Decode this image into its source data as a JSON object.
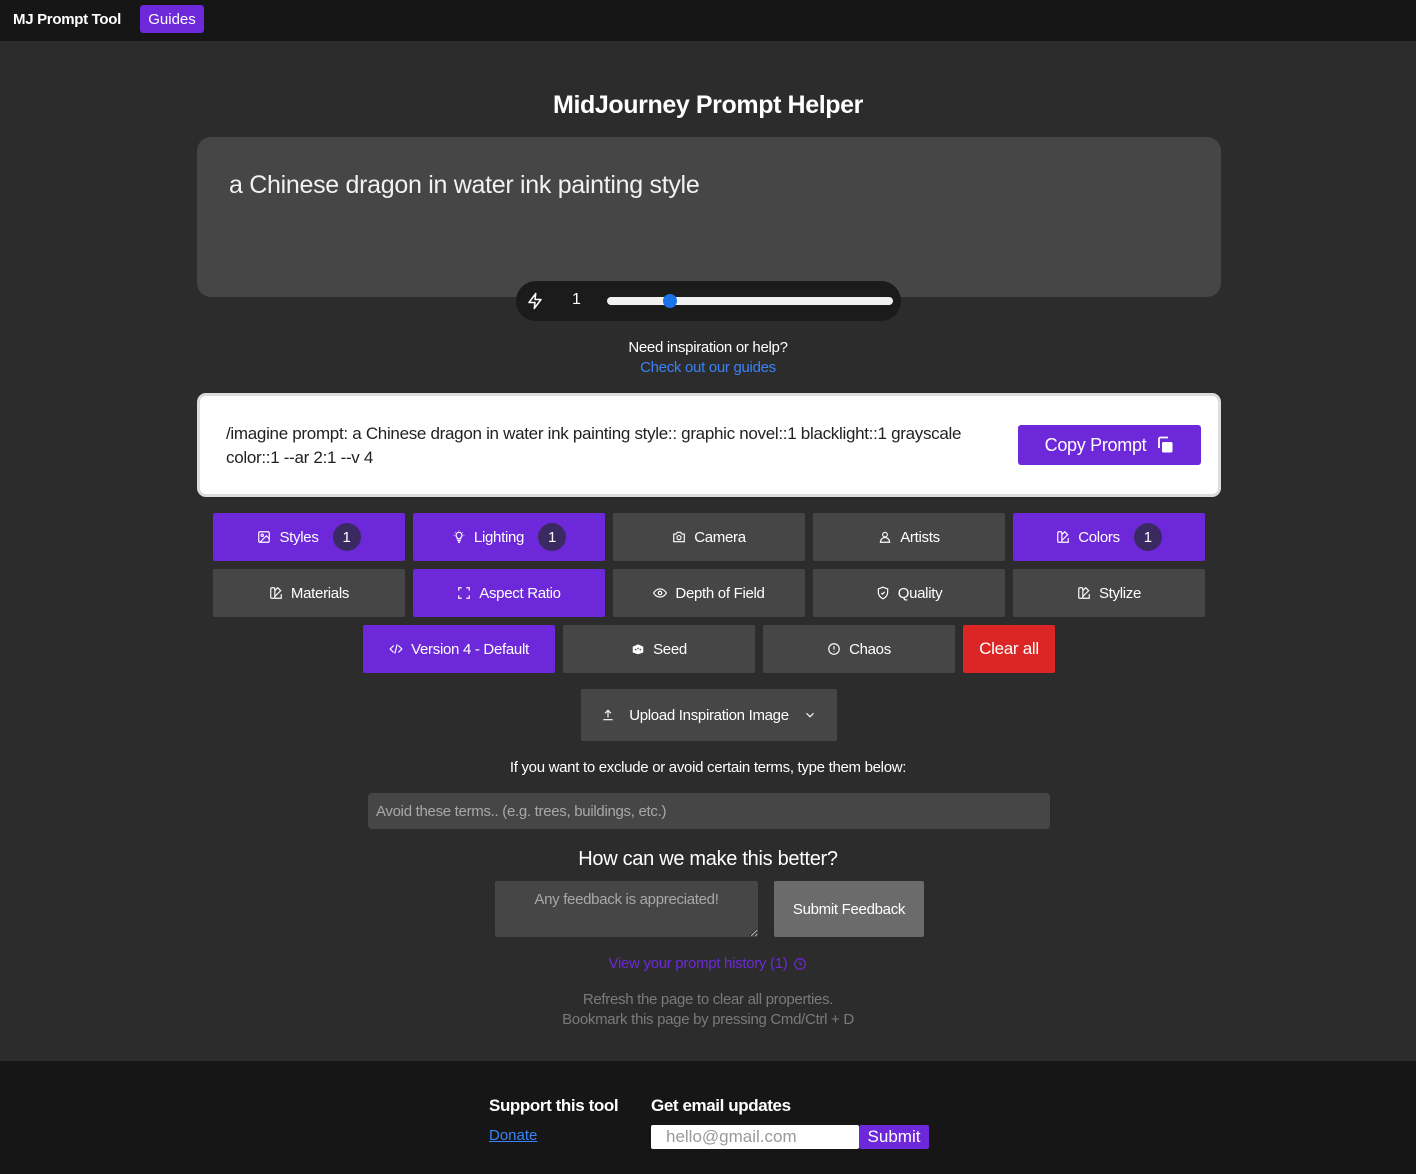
{
  "header": {
    "brand": "MJ Prompt Tool",
    "guides_label": "Guides"
  },
  "title": "MidJourney Prompt Helper",
  "prompt": {
    "text": "a Chinese dragon in water ink painting style"
  },
  "weight": {
    "value": "1",
    "slider_fraction": 0.22
  },
  "help": {
    "text": "Need inspiration or help?",
    "link": "Check out our guides"
  },
  "output": {
    "text": "/imagine prompt: a Chinese dragon in water ink painting style:: graphic novel::1 blacklight::1 grayscale color::1 --ar 2:1 --v 4",
    "copy_label": "Copy Prompt"
  },
  "options": {
    "styles": {
      "label": "Styles",
      "count": "1"
    },
    "lighting": {
      "label": "Lighting",
      "count": "1"
    },
    "camera": {
      "label": "Camera"
    },
    "artists": {
      "label": "Artists"
    },
    "colors": {
      "label": "Colors",
      "count": "1"
    },
    "materials": {
      "label": "Materials"
    },
    "aspect_ratio": {
      "label": "Aspect Ratio"
    },
    "depth_of_field": {
      "label": "Depth of Field"
    },
    "quality": {
      "label": "Quality"
    },
    "stylize": {
      "label": "Stylize"
    },
    "version": {
      "label": "Version 4 - Default"
    },
    "seed": {
      "label": "Seed"
    },
    "chaos": {
      "label": "Chaos"
    },
    "clear_all": {
      "label": "Clear all"
    }
  },
  "upload": {
    "label": "Upload Inspiration Image"
  },
  "exclude": {
    "label": "If you want to exclude or avoid certain terms, type them below:",
    "placeholder": "Avoid these terms.. (e.g. trees, buildings, etc.)"
  },
  "feedback": {
    "title": "How can we make this better?",
    "placeholder": "Any feedback is appreciated!",
    "submit_label": "Submit Feedback"
  },
  "history": {
    "label": "View your prompt history (1)"
  },
  "notes": {
    "line1": "Refresh the page to clear all properties.",
    "line2": "Bookmark this page by pressing Cmd/Ctrl + D"
  },
  "footer": {
    "support_title": "Support this tool",
    "donate_label": "Donate",
    "email_title": "Get email updates",
    "email_placeholder": "hello@gmail.com",
    "submit_label": "Submit"
  },
  "colors": {
    "accent": "#6d28d9",
    "danger": "#dc2626",
    "link": "#3b82f6",
    "slider_knob": "#1a73e8"
  },
  "icons": [
    "bolt-icon",
    "copy-icon",
    "image-icon",
    "bulb-icon",
    "camera-icon",
    "users-icon",
    "palette-icon",
    "expand-icon",
    "eye-icon",
    "shield-icon",
    "code-icon",
    "dice-icon",
    "alert-circle-icon",
    "upload-icon",
    "chevron-down-icon",
    "clock-icon"
  ]
}
